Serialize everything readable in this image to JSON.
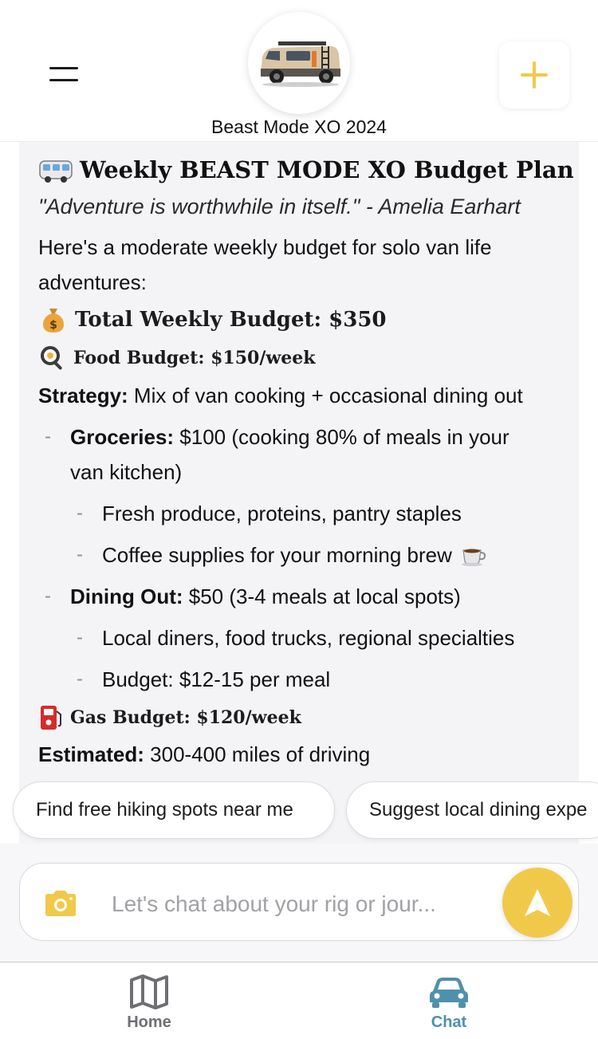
{
  "header": {
    "vehicle_name": "Beast Mode XO 2024"
  },
  "message": {
    "title": "Weekly BEAST MODE XO Budget Plan",
    "quote": "\"Adventure is worthwhile in itself.\" - Amelia Earhart",
    "intro": "Here's a moderate weekly budget for solo van life adventures:",
    "total": "Total Weekly Budget: $350",
    "food": {
      "heading": "Food Budget: $150/week",
      "strategy_label": "Strategy:",
      "strategy_text": " Mix of van cooking + occasional dining out",
      "groceries_label": "Groceries:",
      "groceries_text": " $100 (cooking 80% of meals in your",
      "groceries_text_cont": "van kitchen)",
      "groceries_sub": [
        "Fresh produce, proteins, pantry staples",
        "Coffee supplies for your morning brew"
      ],
      "dining_label": "Dining Out:",
      "dining_text": " $50 (3-4 meals at local spots)",
      "dining_sub": [
        "Local diners, food trucks, regional specialties",
        "Budget: $12-15 per meal"
      ]
    },
    "gas": {
      "heading": "Gas Budget: $120/week",
      "estimated_label": "Estimated:",
      "estimated_text": " 300-400 miles of driving"
    }
  },
  "suggestions": [
    "Find free hiking spots near me",
    "Suggest local dining expe"
  ],
  "composer": {
    "placeholder": "Let's chat about your rig or jour..."
  },
  "tabs": [
    {
      "label": "Home",
      "icon": "map-icon",
      "active": false
    },
    {
      "label": "Chat",
      "icon": "car-icon",
      "active": true
    }
  ],
  "colors": {
    "accent_yellow": "#f1c94a",
    "active_tab": "#4f90ad",
    "inactive_tab": "#6e6e73",
    "message_bg": "#f4f4f7"
  }
}
